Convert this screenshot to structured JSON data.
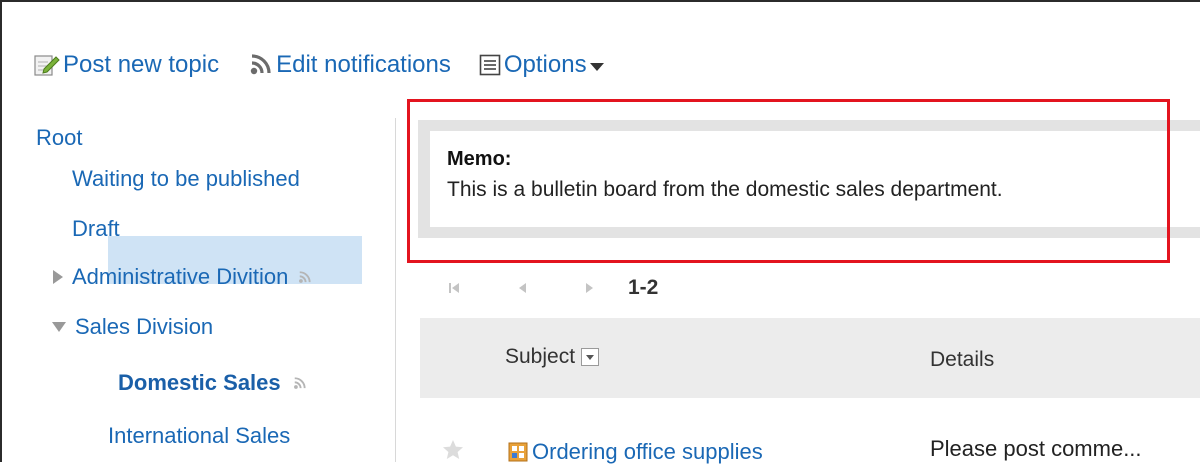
{
  "toolbar": {
    "post_label": "Post new topic",
    "notifications_label": "Edit notifications",
    "options_label": "Options"
  },
  "tree": {
    "root": "Root",
    "waiting": "Waiting to be published",
    "draft": "Draft",
    "admin": "Administrative Divition",
    "sales": "Sales Division",
    "domestic": "Domestic Sales",
    "international": "International Sales"
  },
  "memo": {
    "title": "Memo:",
    "text": "This is a bulletin board from the domestic sales department."
  },
  "pager": {
    "range": "1-2"
  },
  "table": {
    "headers": {
      "subject": "Subject",
      "details": "Details"
    },
    "rows": [
      {
        "subject": "Ordering office supplies",
        "details": "Please post comme..."
      }
    ]
  },
  "colors": {
    "link": "#1a68b5",
    "highlight_box": "#e3141f",
    "selected_bg": "#cfe3f5",
    "memo_border": "#e3e3e3",
    "header_bg": "#ececec"
  }
}
